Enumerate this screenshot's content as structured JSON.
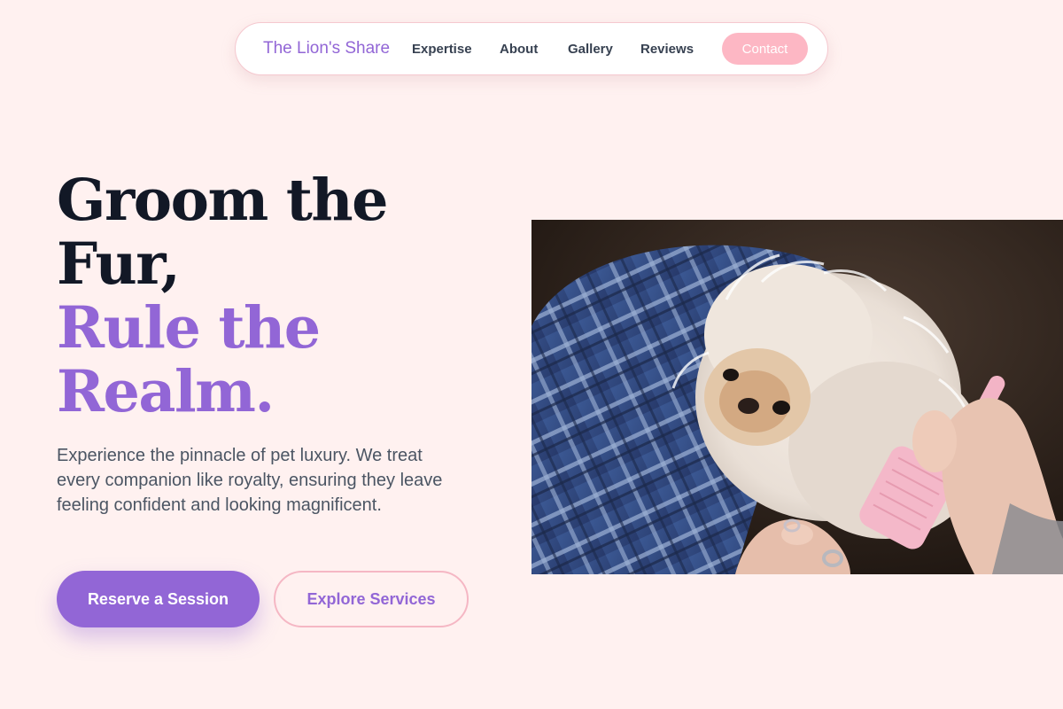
{
  "nav": {
    "brand": "The Lion's Share",
    "links": [
      "Expertise",
      "About",
      "Gallery",
      "Reviews"
    ],
    "cta": "Contact"
  },
  "hero": {
    "headline_line1": "Groom the",
    "headline_line2": "Fur,",
    "headline_accent_line1": "Rule the",
    "headline_accent_line2": "Realm.",
    "description": "Experience the pinnacle of pet luxury. We treat every companion like royalty, ensuring they leave feeling confident and looking magnificent.",
    "primary_button": "Reserve a Session",
    "secondary_button": "Explore Services"
  },
  "colors": {
    "background": "#fff1f0",
    "accent_purple": "#9266d6",
    "accent_pink": "#fdb7c4",
    "heading_dark": "#121826"
  },
  "image": {
    "subject": "fluffy-white-dog-being-brushed-photo"
  }
}
